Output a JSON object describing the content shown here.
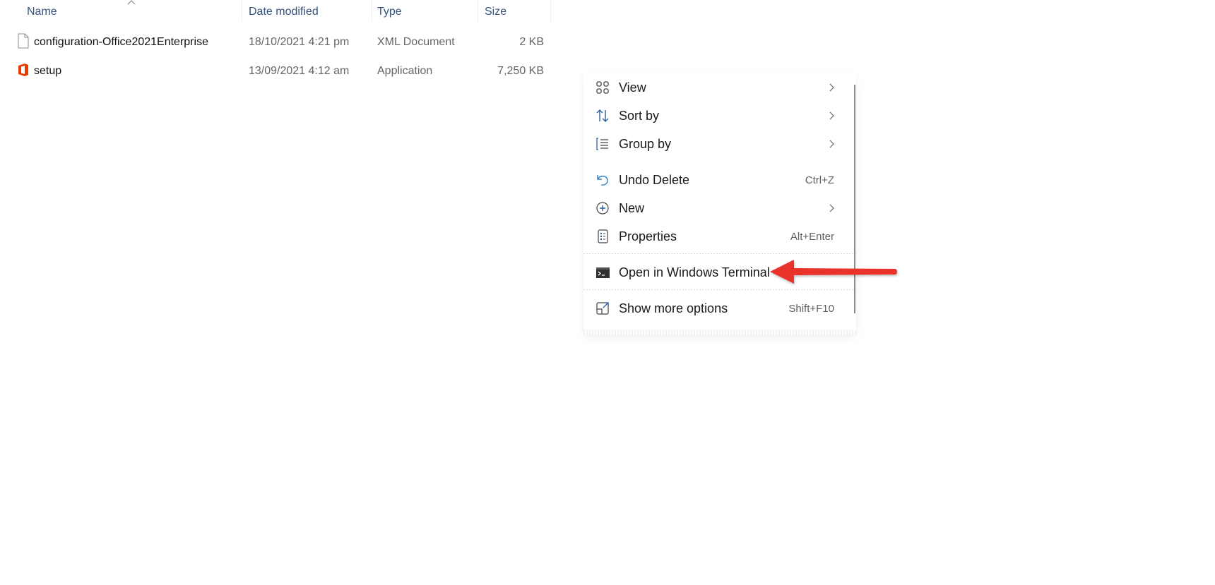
{
  "columns": {
    "name": "Name",
    "date_modified": "Date modified",
    "type": "Type",
    "size": "Size"
  },
  "files": [
    {
      "name": "configuration-Office2021Enterprise",
      "date": "18/10/2021 4:21 pm",
      "type": "XML Document",
      "size": "2 KB",
      "icon": "document-icon"
    },
    {
      "name": "setup",
      "date": "13/09/2021 4:12 am",
      "type": "Application",
      "size": "7,250 KB",
      "icon": "office-app-icon"
    }
  ],
  "context_menu": {
    "items": [
      {
        "label": "View",
        "shortcut": "",
        "submenu": true,
        "icon": "view-grid-icon"
      },
      {
        "label": "Sort by",
        "shortcut": "",
        "submenu": true,
        "icon": "sort-icon"
      },
      {
        "label": "Group by",
        "shortcut": "",
        "submenu": true,
        "icon": "group-icon"
      },
      {
        "label": "Undo Delete",
        "shortcut": "Ctrl+Z",
        "submenu": false,
        "icon": "undo-icon"
      },
      {
        "label": "New",
        "shortcut": "",
        "submenu": true,
        "icon": "new-plus-icon"
      },
      {
        "label": "Properties",
        "shortcut": "Alt+Enter",
        "submenu": false,
        "icon": "properties-icon"
      },
      {
        "label": "Open in Windows Terminal",
        "shortcut": "",
        "submenu": false,
        "icon": "terminal-icon"
      },
      {
        "label": "Show more options",
        "shortcut": "Shift+F10",
        "submenu": false,
        "icon": "show-more-icon"
      }
    ]
  },
  "colors": {
    "header_text": "#35527c",
    "office_orange": "#eb3c00",
    "arrow_red": "#e8322c"
  }
}
